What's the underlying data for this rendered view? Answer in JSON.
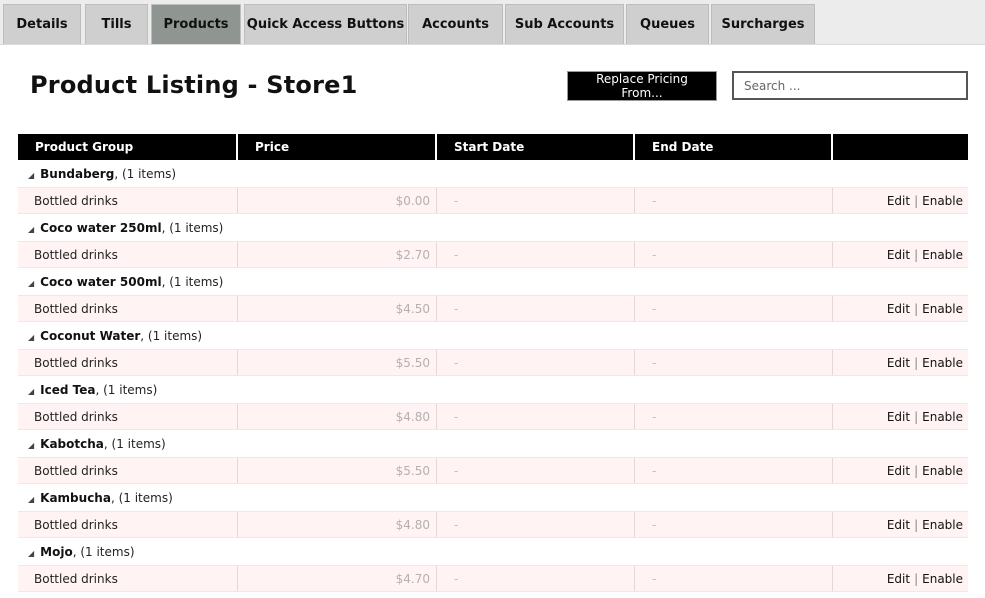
{
  "tabs": [
    {
      "label": "Details",
      "active": false
    },
    {
      "label": "Tills",
      "active": false
    },
    {
      "label": "Products",
      "active": true
    },
    {
      "label": "Quick Access Buttons",
      "active": false
    },
    {
      "label": "Accounts",
      "active": false
    },
    {
      "label": "Sub Accounts",
      "active": false
    },
    {
      "label": "Queues",
      "active": false
    },
    {
      "label": "Surcharges",
      "active": false
    }
  ],
  "page_title": "Product Listing - Store1",
  "replace_button": "Replace Pricing From...",
  "search": {
    "placeholder": "Search ...",
    "value": ""
  },
  "table": {
    "headers": [
      "Product Group",
      "Price",
      "Start Date",
      "End Date",
      ""
    ],
    "groups": [
      {
        "name": "Bundaberg",
        "count": ", (1 items)",
        "rows": [
          {
            "name": "Bottled drinks",
            "price": "$0.00",
            "start": "-",
            "end": "-"
          }
        ]
      },
      {
        "name": "Coco water 250ml",
        "count": ", (1 items)",
        "rows": [
          {
            "name": "Bottled drinks",
            "price": "$2.70",
            "start": "-",
            "end": "-"
          }
        ]
      },
      {
        "name": "Coco water 500ml",
        "count": ", (1 items)",
        "rows": [
          {
            "name": "Bottled drinks",
            "price": "$4.50",
            "start": "-",
            "end": "-"
          }
        ]
      },
      {
        "name": "Coconut Water",
        "count": ", (1 items)",
        "rows": [
          {
            "name": "Bottled drinks",
            "price": "$5.50",
            "start": "-",
            "end": "-"
          }
        ]
      },
      {
        "name": "Iced Tea",
        "count": ", (1 items)",
        "rows": [
          {
            "name": "Bottled drinks",
            "price": "$4.80",
            "start": "-",
            "end": "-"
          }
        ]
      },
      {
        "name": "Kabotcha",
        "count": ", (1 items)",
        "rows": [
          {
            "name": "Bottled drinks",
            "price": "$5.50",
            "start": "-",
            "end": "-"
          }
        ]
      },
      {
        "name": "Kambucha",
        "count": ", (1 items)",
        "rows": [
          {
            "name": "Bottled drinks",
            "price": "$4.80",
            "start": "-",
            "end": "-"
          }
        ]
      },
      {
        "name": "Mojo",
        "count": ", (1 items)",
        "rows": [
          {
            "name": "Bottled drinks",
            "price": "$4.70",
            "start": "-",
            "end": "-"
          }
        ]
      }
    ],
    "actions": {
      "edit": "Edit",
      "separator": "|",
      "enable": "Enable"
    },
    "caret_icon": "◢"
  }
}
